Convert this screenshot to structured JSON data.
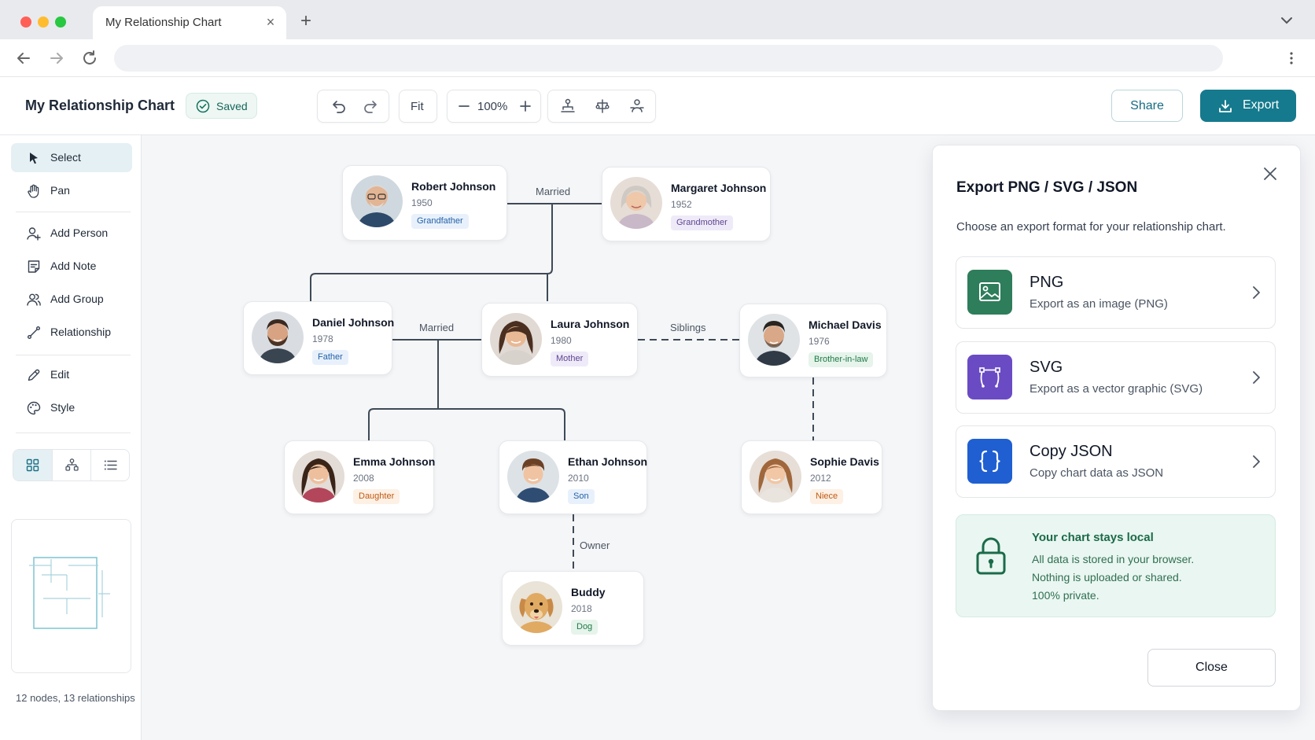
{
  "browser": {
    "tab_title": "My Relationship Chart",
    "close_tab": "×",
    "new_tab": "+"
  },
  "app": {
    "title": "My Relationship Chart",
    "saved_label": "Saved",
    "fit_label": "Fit",
    "zoom_level": "100%",
    "share_label": "Share",
    "export_label": "Export"
  },
  "sidebar": {
    "items": [
      {
        "label": "Select",
        "icon": "cursor-icon"
      },
      {
        "label": "Pan",
        "icon": "hand-icon"
      },
      {
        "label": "Add Person",
        "icon": "add-person-icon"
      },
      {
        "label": "Add Note",
        "icon": "note-icon"
      },
      {
        "label": "Add Group",
        "icon": "group-icon"
      },
      {
        "label": "Relationship",
        "icon": "relationship-icon"
      },
      {
        "label": "Edit",
        "icon": "pencil-icon"
      },
      {
        "label": "Style",
        "icon": "palette-icon"
      }
    ],
    "stats": "12 nodes, 13 relationships"
  },
  "chart": {
    "nodes": [
      {
        "name": "Robert Johnson",
        "year": "1950",
        "role": "Grandfather",
        "badge_color": "blue"
      },
      {
        "name": "Margaret Johnson",
        "year": "1952",
        "role": "Grandmother",
        "badge_color": "purple"
      },
      {
        "name": "Daniel Johnson",
        "year": "1978",
        "role": "Father",
        "badge_color": "blue"
      },
      {
        "name": "Laura Johnson",
        "year": "1980",
        "role": "Mother",
        "badge_color": "purple"
      },
      {
        "name": "Michael Davis",
        "year": "1976",
        "role": "Brother-in-law",
        "badge_color": "green"
      },
      {
        "name": "Emma Johnson",
        "year": "2008",
        "role": "Daughter",
        "badge_color": "orange"
      },
      {
        "name": "Ethan Johnson",
        "year": "2010",
        "role": "Son",
        "badge_color": "blue"
      },
      {
        "name": "Sophie Davis",
        "year": "2012",
        "role": "Niece",
        "badge_color": "orange"
      },
      {
        "name": "Buddy",
        "year": "2018",
        "role": "Dog",
        "badge_color": "green"
      }
    ],
    "relationship_labels": {
      "married_top": "Married",
      "married_mid": "Married",
      "siblings": "Siblings",
      "owner": "Owner"
    }
  },
  "export_panel": {
    "title": "Export PNG / SVG / JSON",
    "description": "Choose an export format for your relationship chart.",
    "options": [
      {
        "title": "PNG",
        "desc": "Export as an image (PNG)",
        "color": "#2e7d5b",
        "icon": "image-icon"
      },
      {
        "title": "SVG",
        "desc": "Export as a vector graphic (SVG)",
        "color": "#6a4bc4",
        "icon": "vector-icon"
      },
      {
        "title": "Copy JSON",
        "desc": "Copy chart data as JSON",
        "color": "#1f5fd1",
        "icon": "braces-icon"
      }
    ],
    "local": {
      "heading": "Your chart stays local",
      "line1": "All data is stored in your browser.",
      "line2": "Nothing is uploaded or shared.",
      "line3": "100% private."
    },
    "close_label": "Close"
  },
  "colors": {
    "accent": "#157a8d",
    "line": "#3f4a57"
  }
}
